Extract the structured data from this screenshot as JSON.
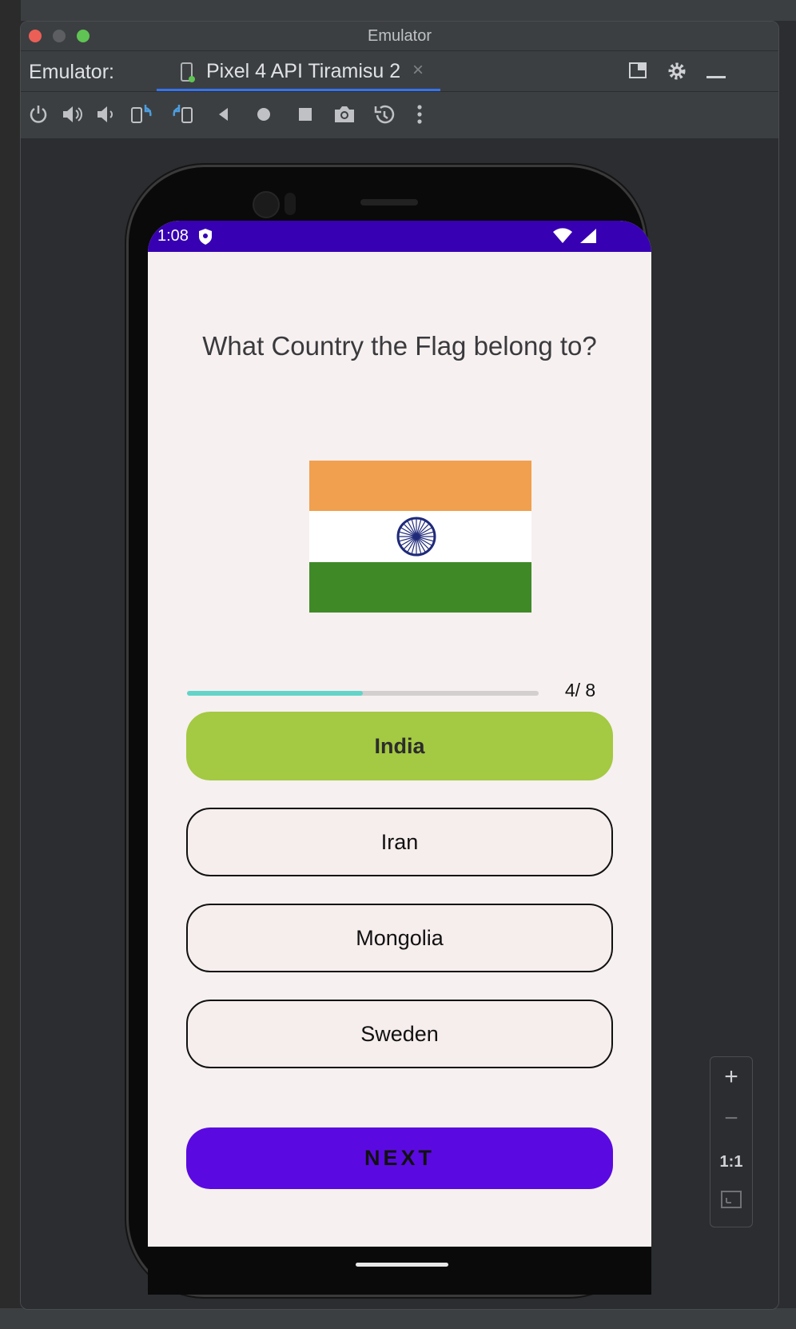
{
  "window": {
    "title": "Emulator"
  },
  "toolwindow": {
    "label": "Emulator:",
    "tab_label": "Pixel 4 API Tiramisu 2",
    "tab_close": "×"
  },
  "toolbar": {
    "icons": [
      "power-icon",
      "volume-up-icon",
      "volume-down-icon",
      "rotate-left-icon",
      "rotate-right-icon",
      "back-icon",
      "home-icon",
      "overview-icon",
      "screenshot-icon",
      "snapshot-icon",
      "more-icon"
    ]
  },
  "statusbar": {
    "time": "1:08"
  },
  "quiz": {
    "question": "What Country the Flag belong to?",
    "progress_text": "4/ 8",
    "progress_value": 0.5,
    "options": [
      {
        "label": "India",
        "selected": true
      },
      {
        "label": "Iran",
        "selected": false
      },
      {
        "label": "Mongolia",
        "selected": false
      },
      {
        "label": "Sweden",
        "selected": false
      }
    ],
    "next_label": "NEXT"
  },
  "zoom": {
    "zoom_in": "+",
    "zoom_out": "−",
    "actual_size": "1:1"
  },
  "colors": {
    "status_bar": "#3700b3",
    "selected_option": "#a4c942",
    "next_button": "#5a0ae0",
    "progress": "#62d4c8",
    "flag_saffron": "#f0a04e",
    "flag_white": "#ffffff",
    "flag_green": "#3f8a27",
    "chakra": "#1f2a7a"
  }
}
